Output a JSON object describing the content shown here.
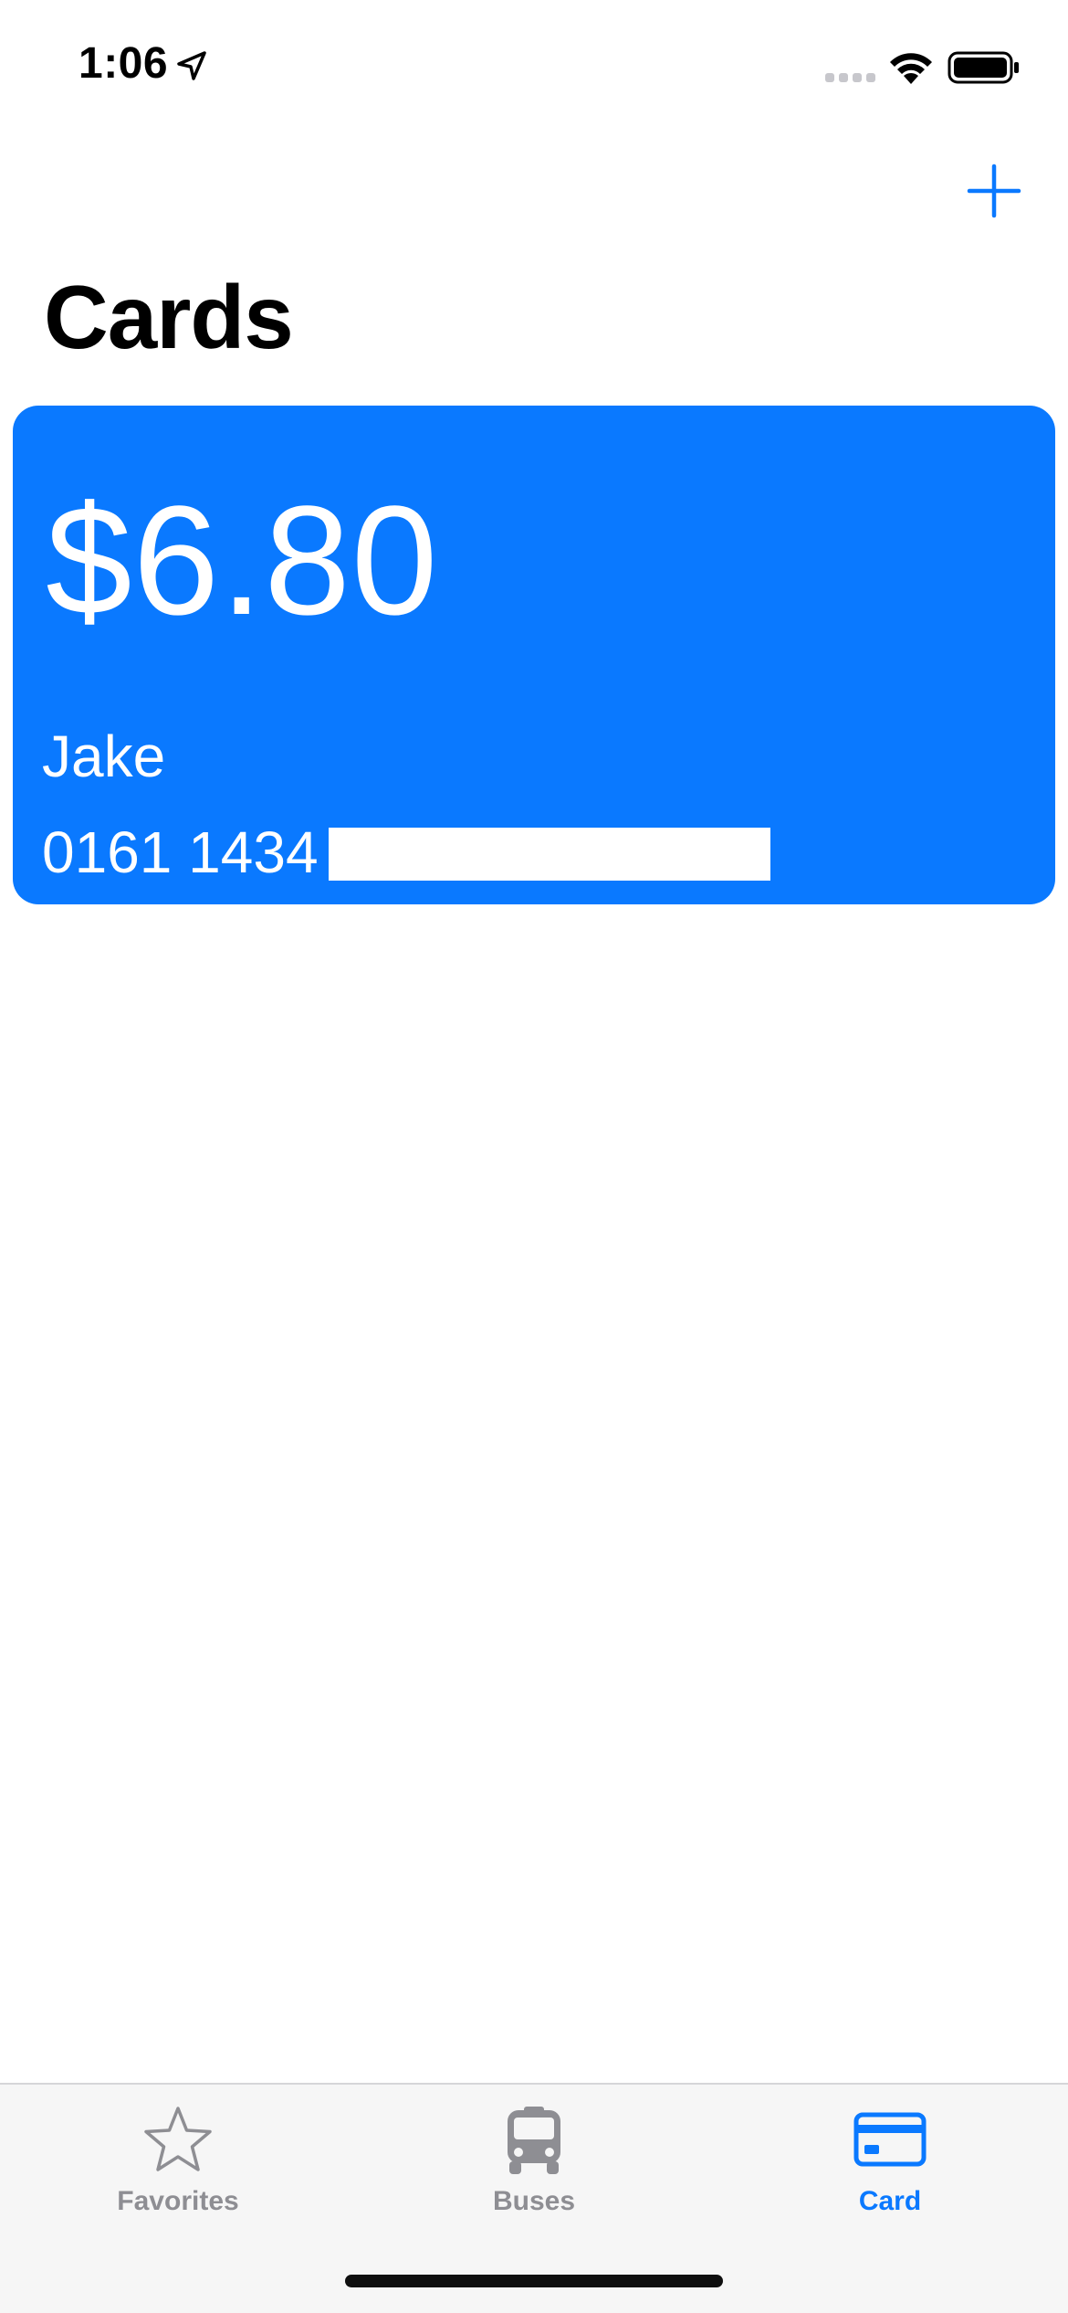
{
  "status_bar": {
    "time": "1:06"
  },
  "nav": {
    "title": "Cards",
    "add_icon": "plus-icon"
  },
  "card": {
    "balance": "$6.80",
    "name": "Jake",
    "number": "0161 1434",
    "color": "#0a79ff"
  },
  "tab_bar": {
    "active_color": "#0a79ff",
    "inactive_color": "#8e8e93",
    "tabs": [
      {
        "label": "Favorites",
        "icon": "star-icon"
      },
      {
        "label": "Buses",
        "icon": "bus-icon"
      },
      {
        "label": "Card",
        "icon": "credit-card-icon"
      }
    ],
    "selected": "Card"
  }
}
